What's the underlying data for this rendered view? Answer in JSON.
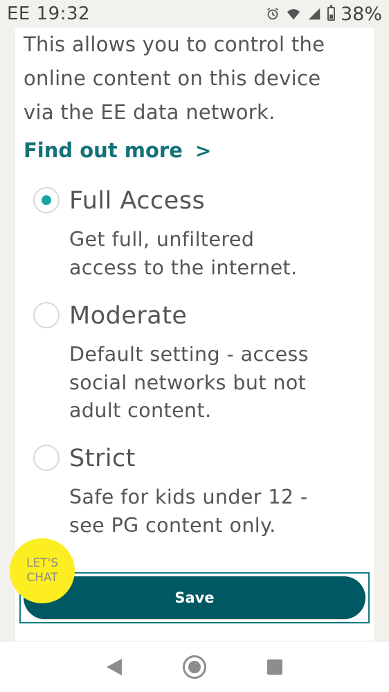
{
  "status_bar": {
    "carrier_time": "EE 19:32",
    "battery": "38%",
    "icons": [
      "alarm-icon",
      "wifi-icon",
      "signal-icon",
      "battery-icon"
    ]
  },
  "intro": {
    "line1": "This allows you to control the",
    "line2": "online content on this device",
    "line3": "via the EE data network."
  },
  "find_more": {
    "label": "Find out more",
    "chevron": ">"
  },
  "options": [
    {
      "title": "Full Access",
      "desc_line1": "Get full, unfiltered",
      "desc_line2": "access to the internet.",
      "selected": true
    },
    {
      "title": "Moderate",
      "desc_line1": "Default setting - access",
      "desc_line2": "social networks but not",
      "desc_line3": "adult content.",
      "selected": false
    },
    {
      "title": "Strict",
      "desc_line1": "Safe for kids under 12 -",
      "desc_line2": "see PG content only.",
      "selected": false
    }
  ],
  "save_button": {
    "label": "Save"
  },
  "chat": {
    "line1": "LET'S",
    "line2": "CHAT"
  },
  "colors": {
    "accent": "#137278",
    "radio_selected": "#17a5a1",
    "save_bg": "#005862",
    "chat_bg": "#fcee21"
  }
}
